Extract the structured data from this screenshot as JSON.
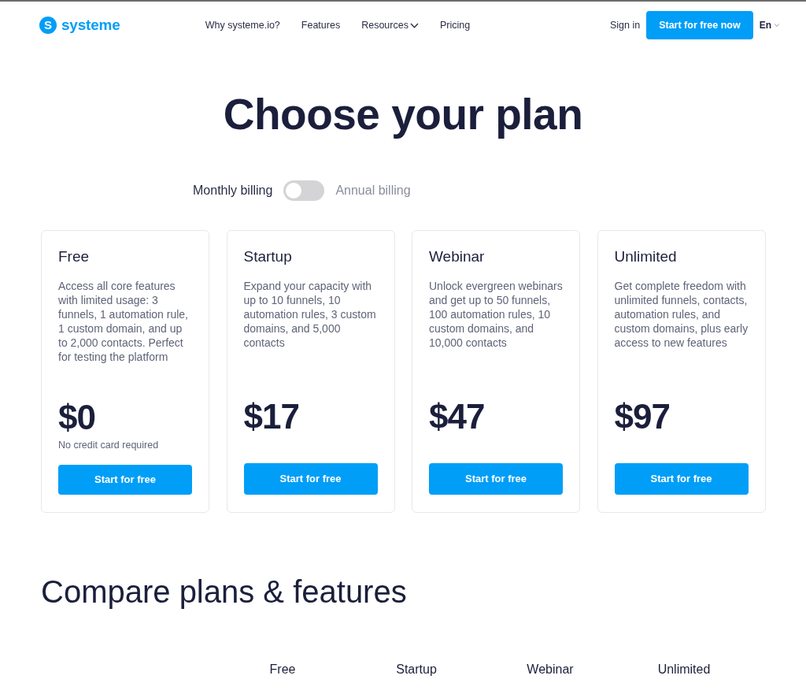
{
  "header": {
    "logo": {
      "mark": "S",
      "text": "systeme"
    },
    "nav": [
      {
        "label": "Why systeme.io?",
        "kind": "link"
      },
      {
        "label": "Features",
        "kind": "link"
      },
      {
        "label": "Resources",
        "kind": "dropdown"
      },
      {
        "label": "Pricing",
        "kind": "link"
      }
    ],
    "sign_in": "Sign in",
    "cta": "Start for free now",
    "language": "En"
  },
  "hero": {
    "title": "Choose your plan",
    "billing": {
      "left_label": "Monthly billing",
      "right_label": "Annual billing",
      "on": false
    }
  },
  "plans": [
    {
      "name": "Free",
      "description": "Access all core features with limited usage: 3 funnels, 1 automation rule, 1 custom domain, and up to 2,000 contacts. Perfect for testing the platform",
      "price": "$0",
      "note": "No credit card required",
      "button": "Start for free"
    },
    {
      "name": "Startup",
      "description": "Expand your capacity with up to 10 funnels, 10 automation rules, 3 custom domains, and 5,000 contacts",
      "price": "$17",
      "button": "Start for free"
    },
    {
      "name": "Webinar",
      "description": "Unlock evergreen webinars and get up to 50 funnels, 100 automation rules, 10 custom domains, and 10,000 contacts",
      "price": "$47",
      "button": "Start for free"
    },
    {
      "name": "Unlimited",
      "description": "Get complete freedom with unlimited funnels, contacts, automation rules, and custom domains, plus early access to new features",
      "price": "$97",
      "button": "Start for free"
    }
  ],
  "compare": {
    "title": "Compare plans & features",
    "columns": [
      "Free",
      "Startup",
      "Webinar",
      "Unlimited"
    ]
  }
}
